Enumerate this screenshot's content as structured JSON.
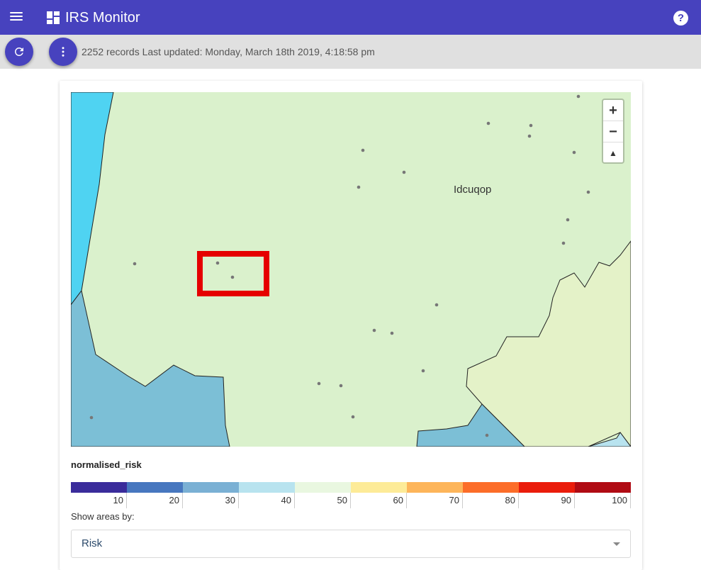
{
  "app": {
    "title": "IRS Monitor"
  },
  "toolbar": {
    "status": "2252 records Last updated: Monday, March 18th 2019, 4:18:58 pm"
  },
  "map": {
    "place_label": "Idcuqop",
    "zoom_in": "+",
    "zoom_out": "−",
    "reset_north": "▲"
  },
  "legend": {
    "title": "normalised_risk",
    "ticks": [
      "10",
      "20",
      "30",
      "40",
      "50",
      "60",
      "70",
      "80",
      "90",
      "100"
    ],
    "colors": [
      "#3a2c9b",
      "#4777bf",
      "#7ab0d4",
      "#b8e3ef",
      "#e9f7e0",
      "#fdeb98",
      "#fdb55a",
      "#fc6d29",
      "#ea1c0b",
      "#b00b14"
    ]
  },
  "controls": {
    "show_areas_label": "Show areas by:",
    "show_areas_value": "Risk"
  }
}
